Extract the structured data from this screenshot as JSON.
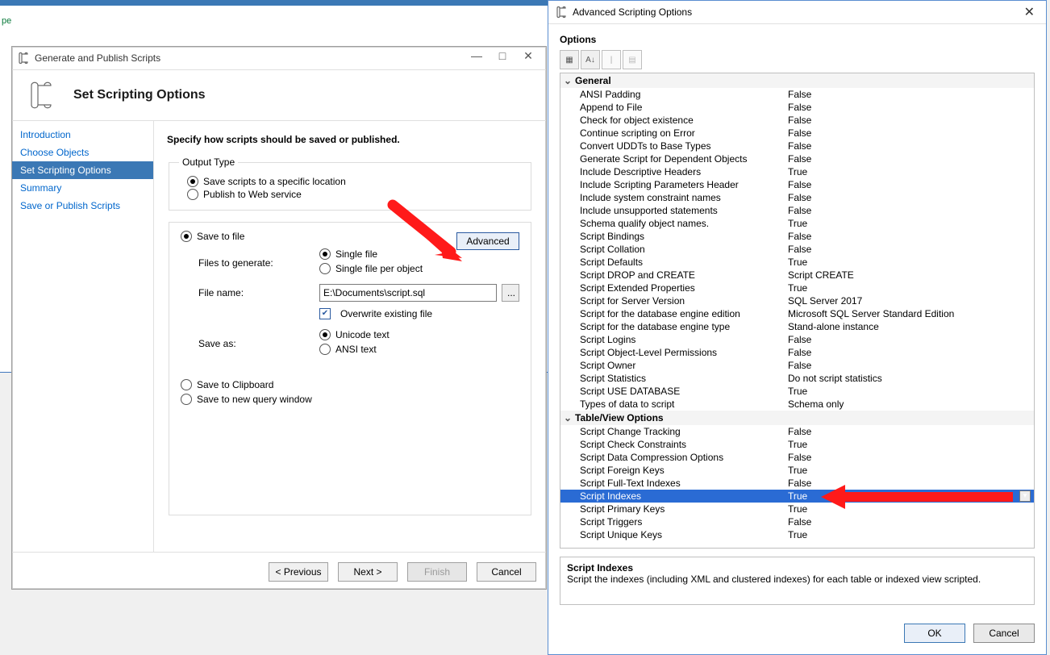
{
  "wizard": {
    "window_title": "Generate and Publish Scripts",
    "header_title": "Set Scripting Options",
    "nav": {
      "items": [
        {
          "label": "Introduction"
        },
        {
          "label": "Choose Objects"
        },
        {
          "label": "Set Scripting Options"
        },
        {
          "label": "Summary"
        },
        {
          "label": "Save or Publish Scripts"
        }
      ],
      "selected_index": 2
    },
    "main": {
      "lead": "Specify how scripts should be saved or published.",
      "output_type_legend": "Output Type",
      "output_type_options": [
        "Save scripts to a specific location",
        "Publish to Web service"
      ],
      "output_type_selected": 0,
      "advanced_button": "Advanced",
      "dest_options": [
        "Save to file",
        "Save to Clipboard",
        "Save to new query window"
      ],
      "dest_selected": 0,
      "files_to_generate_label": "Files to generate:",
      "files_to_generate_options": [
        "Single file",
        "Single file per object"
      ],
      "files_to_generate_selected": 0,
      "file_name_label": "File name:",
      "file_name_value": "E:\\Documents\\script.sql",
      "browse_button": "...",
      "overwrite_label": "Overwrite existing file",
      "overwrite_checked": true,
      "save_as_label": "Save as:",
      "save_as_options": [
        "Unicode text",
        "ANSI text"
      ],
      "save_as_selected": 0
    },
    "footer": {
      "prev": "< Previous",
      "next": "Next >",
      "finish": "Finish",
      "cancel": "Cancel"
    },
    "sysbuttons": {
      "min": "—",
      "max": "□",
      "close": "✕"
    }
  },
  "adv": {
    "window_title": "Advanced Scripting Options",
    "options_label": "Options",
    "toolbar_icons": [
      "categorized-icon",
      "alpha-sort-icon",
      "property-pages-icon"
    ],
    "groups": [
      {
        "name": "General",
        "rows": [
          {
            "k": "ANSI Padding",
            "v": "False"
          },
          {
            "k": "Append to File",
            "v": "False"
          },
          {
            "k": "Check for object existence",
            "v": "False"
          },
          {
            "k": "Continue scripting on Error",
            "v": "False"
          },
          {
            "k": "Convert UDDTs to Base Types",
            "v": "False"
          },
          {
            "k": "Generate Script for Dependent Objects",
            "v": "False"
          },
          {
            "k": "Include Descriptive Headers",
            "v": "True"
          },
          {
            "k": "Include Scripting Parameters Header",
            "v": "False"
          },
          {
            "k": "Include system constraint names",
            "v": "False"
          },
          {
            "k": "Include unsupported statements",
            "v": "False"
          },
          {
            "k": "Schema qualify object names.",
            "v": "True"
          },
          {
            "k": "Script Bindings",
            "v": "False"
          },
          {
            "k": "Script Collation",
            "v": "False"
          },
          {
            "k": "Script Defaults",
            "v": "True"
          },
          {
            "k": "Script DROP and CREATE",
            "v": "Script CREATE"
          },
          {
            "k": "Script Extended Properties",
            "v": "True"
          },
          {
            "k": "Script for Server Version",
            "v": "SQL Server 2017"
          },
          {
            "k": "Script for the database engine edition",
            "v": "Microsoft SQL Server Standard Edition"
          },
          {
            "k": "Script for the database engine type",
            "v": "Stand-alone instance"
          },
          {
            "k": "Script Logins",
            "v": "False"
          },
          {
            "k": "Script Object-Level Permissions",
            "v": "False"
          },
          {
            "k": "Script Owner",
            "v": "False"
          },
          {
            "k": "Script Statistics",
            "v": "Do not script statistics"
          },
          {
            "k": "Script USE DATABASE",
            "v": "True"
          },
          {
            "k": "Types of data to script",
            "v": "Schema only"
          }
        ]
      },
      {
        "name": "Table/View Options",
        "rows": [
          {
            "k": "Script Change Tracking",
            "v": "False"
          },
          {
            "k": "Script Check Constraints",
            "v": "True"
          },
          {
            "k": "Script Data Compression Options",
            "v": "False"
          },
          {
            "k": "Script Foreign Keys",
            "v": "True"
          },
          {
            "k": "Script Full-Text Indexes",
            "v": "False"
          },
          {
            "k": "Script Indexes",
            "v": "True",
            "selected": true
          },
          {
            "k": "Script Primary Keys",
            "v": "True"
          },
          {
            "k": "Script Triggers",
            "v": "False"
          },
          {
            "k": "Script Unique Keys",
            "v": "True"
          }
        ]
      }
    ],
    "description": {
      "title": "Script Indexes",
      "text": "Script the indexes (including XML and clustered indexes) for each table or indexed view scripted."
    },
    "footer": {
      "ok": "OK",
      "cancel": "Cancel"
    }
  }
}
